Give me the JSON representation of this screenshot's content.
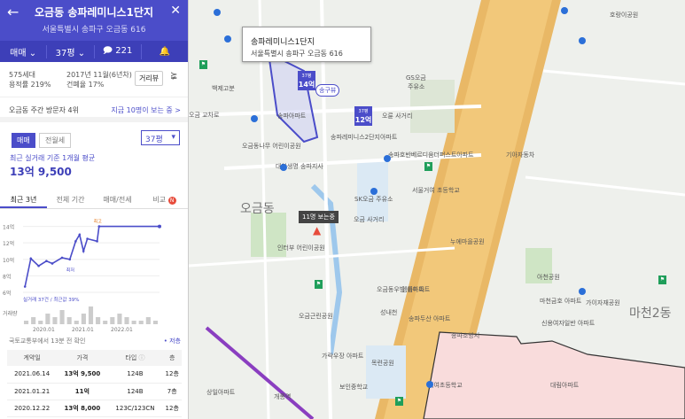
{
  "header": {
    "title": "오금동 송파레미니스1단지",
    "address": "서울특별시 송파구 오금동 616",
    "deal_type": "매매",
    "size": "37평",
    "comments": "221"
  },
  "summary": {
    "households": "575세대",
    "floor_area_ratio": "용적률 219%",
    "built": "2017년 11월(6년차)",
    "coverage": "건폐율 17%",
    "distance_button": "거리뷰"
  },
  "visitors": {
    "text": "오금동 주간 방문자 4위",
    "link": "지금 10명이 보는 중 >"
  },
  "price": {
    "tab_sale": "매매",
    "tab_rent": "전월세",
    "size_select": "37평",
    "subtitle": "최근 실거래 기준 1개월 평균",
    "value": "13억 9,500"
  },
  "period_tabs": [
    "최근 3년",
    "전체 기간",
    "매매/전세",
    "비교"
  ],
  "compare_badge": "N",
  "chart_data": {
    "type": "line",
    "y_ticks": [
      "14억",
      "12억",
      "10억",
      "8억",
      "6억"
    ],
    "ylim": [
      6,
      14.6
    ],
    "x_ticks": [
      "2020.01",
      "2021.01",
      "2022.01"
    ],
    "x_tick_positions": [
      2020.0,
      2021.0,
      2022.0
    ],
    "xlim": [
      2019.5,
      2023.0
    ],
    "series": [
      {
        "name": "최고",
        "x": [
          2019.55,
          2019.7,
          2019.9,
          2020.1,
          2020.25,
          2020.5,
          2020.7,
          2020.85,
          2020.95,
          2021.05,
          2021.15,
          2021.4,
          2021.45,
          2023.0
        ],
        "y": [
          6.7,
          10.1,
          9.2,
          9.8,
          9.5,
          10.2,
          10.0,
          12.2,
          13.0,
          11.0,
          12.5,
          12.2,
          14.0,
          14.0
        ]
      }
    ],
    "max_label": "최고",
    "min_label": "최저",
    "area_legend": "실거래 37건 / 최근값 39%",
    "volume_label": "거래량",
    "volume": [
      1,
      2,
      1,
      3,
      2,
      4,
      2,
      1,
      3,
      5,
      2,
      1,
      2,
      3,
      2,
      1,
      1,
      2,
      1
    ]
  },
  "source": {
    "text": "국토교통부에서 13분 전 확인",
    "legend": "• 저층"
  },
  "table": {
    "headers": [
      "계약일",
      "가격",
      "타입",
      "층"
    ],
    "rows": [
      [
        "2021.06.14",
        "13억 9,500",
        "124B",
        "12층"
      ],
      [
        "2021.01.21",
        "11억",
        "124B",
        "7층"
      ],
      [
        "2020.12.22",
        "13억 8,000",
        "123C/123CN",
        "12층"
      ]
    ]
  },
  "map": {
    "popup_title": "송파레미니스1단지",
    "popup_address": "서울특별시 송파구 오금동 616",
    "markers": [
      {
        "size": "37평",
        "price": "14억"
      },
      {
        "size": "37평",
        "price": "12억"
      }
    ],
    "pill": "송구뷰",
    "viewers_tag": "11명 보는중",
    "district_1": "오금동",
    "district_2": "마천2동",
    "labels": [
      "백제고분",
      "호랑이공원",
      "GS오금",
      "주유소",
      "오륜 사거리",
      "오금 교차로",
      "송파아파트",
      "송파레미니스2단지아파트",
      "송파호반베르디움더퍼스트아파트",
      "오금동나무 어린이공원",
      "대한생명 송파지사",
      "SK오금 주유소",
      "서울거여 초등학교",
      "오금 사거리",
      "누에마을공원",
      "기아자동차",
      "인터부 어린이공원",
      "아천공원",
      "오금동우방 아파트",
      "엠플아파트",
      "성내천",
      "송파두산 아파트",
      "오금근린공원",
      "가락우장 아파트",
      "목련공원",
      "보인중학교",
      "송파소방서",
      "신용여자일반 아파트",
      "마천금호 아파트",
      "가이자재공원",
      "개롱역",
      "거여초등학교",
      "대림아파트",
      "상일아파트"
    ]
  }
}
